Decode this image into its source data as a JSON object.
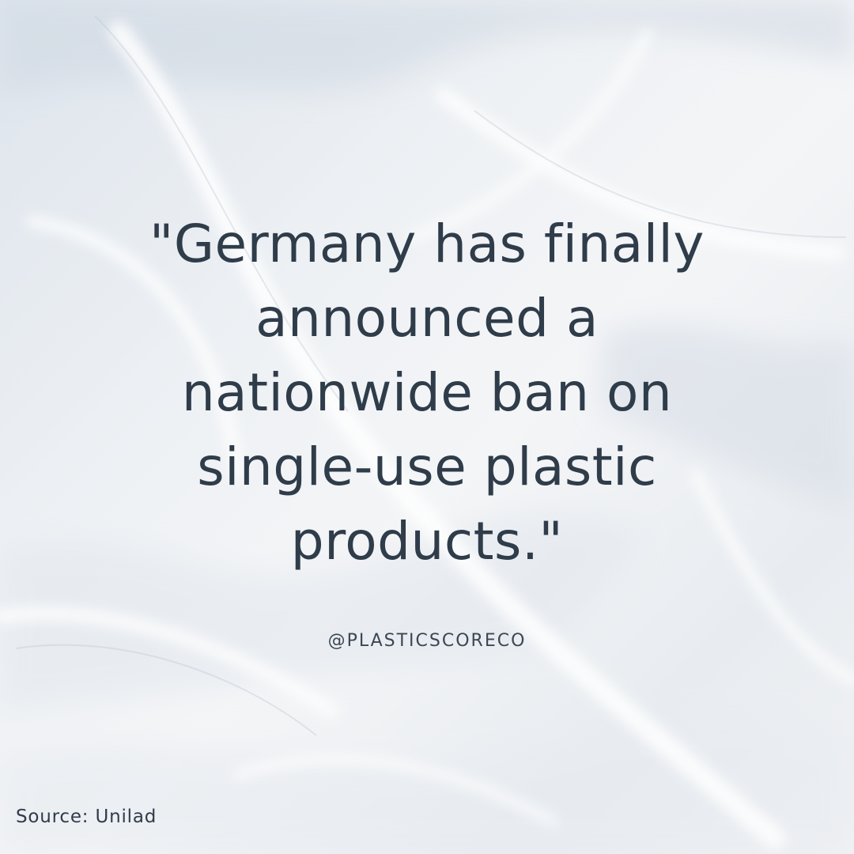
{
  "quote": {
    "lines": [
      "\"Germany has finally",
      "announced a",
      "nationwide ban on",
      "single-use plastic",
      "products.\""
    ]
  },
  "handle": "@PLASTICSCORECO",
  "source": "Source: Unilad",
  "colors": {
    "text": "#2f3c4a",
    "background": "#eef1f4"
  }
}
